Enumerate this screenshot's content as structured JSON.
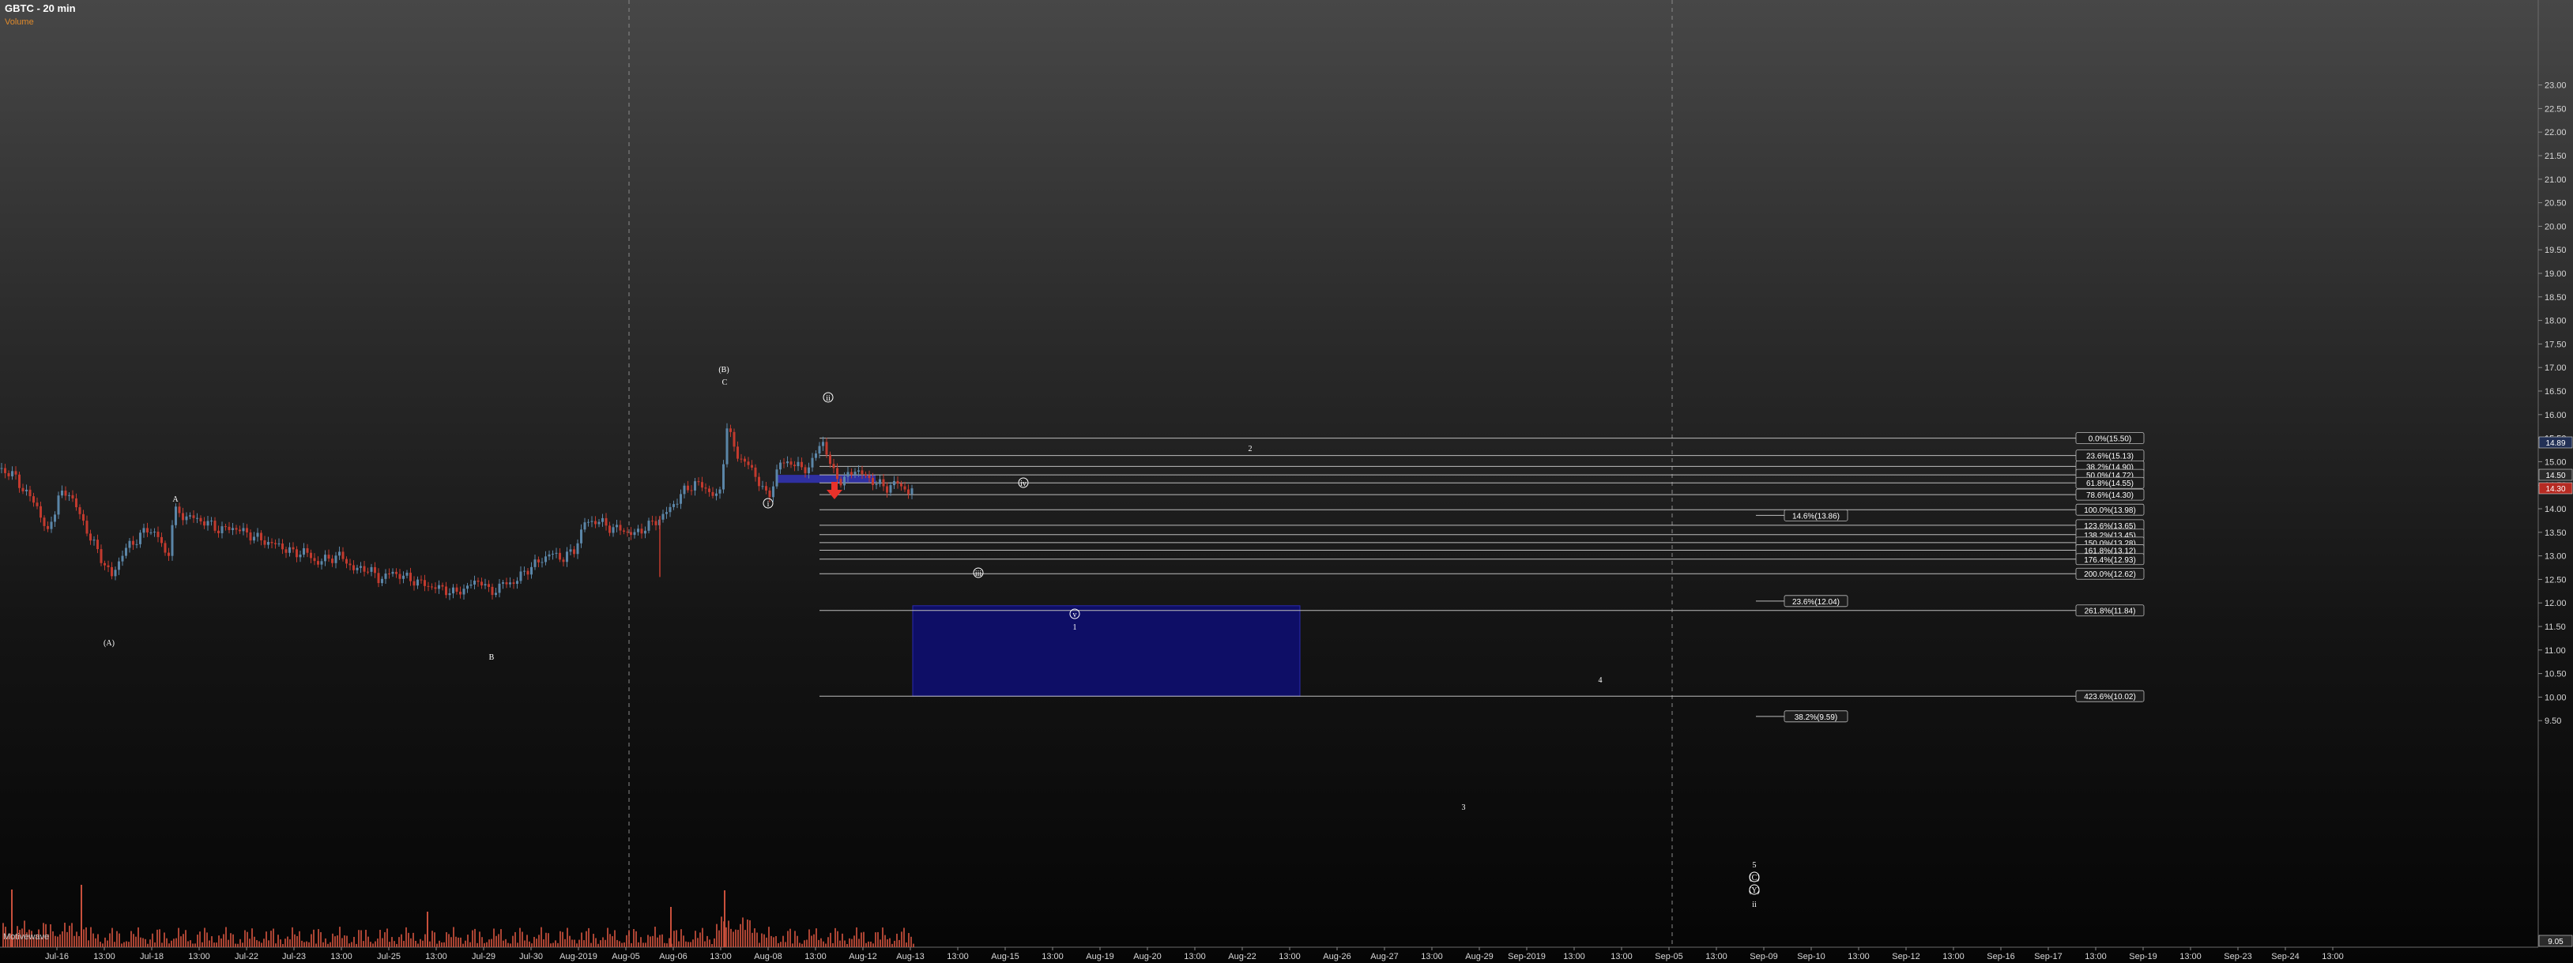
{
  "header": {
    "title": "GBTC - 20 min",
    "subtitle": "Volume"
  },
  "watermark": "Motivewave",
  "colors": {
    "grid": "#8a8a8a",
    "fib_line": "#bdbdbd",
    "candle_up": "#5b86a8",
    "candle_down": "#c23a2e",
    "volume": "#c9503c",
    "zone_fill": "#0e0e66",
    "zone_small": "#3234b8",
    "label_fill": "#1c1c1c",
    "arrow": "#e8322a"
  },
  "chart_data": {
    "type": "candlestick",
    "y_axis": {
      "range": [
        9.05,
        23.5
      ],
      "ticks": [
        "9.50",
        "10.00",
        "10.50",
        "11.00",
        "11.50",
        "12.00",
        "12.50",
        "13.00",
        "13.50",
        "14.00",
        "14.50",
        "15.00",
        "15.50",
        "16.00",
        "16.50",
        "17.00",
        "17.50",
        "18.00",
        "18.50",
        "19.00",
        "19.50",
        "20.00",
        "20.50",
        "21.00",
        "21.50",
        "22.00",
        "22.50",
        "23.00"
      ],
      "price_tags": [
        "14.89",
        "14.50",
        "14.30",
        "9.05"
      ]
    },
    "x_axis": {
      "labels": [
        "Jul-16",
        "13:00",
        "Jul-18",
        "13:00",
        "Jul-22",
        "Jul-23",
        "13:00",
        "Jul-25",
        "13:00",
        "Jul-29",
        "Jul-30",
        "Aug-2019",
        "Aug-05",
        "Aug-06",
        "13:00",
        "Aug-08",
        "13:00",
        "Aug-12",
        "Aug-13",
        "13:00",
        "Aug-15",
        "13:00",
        "Aug-19",
        "Aug-20",
        "13:00",
        "Aug-22",
        "13:00",
        "Aug-26",
        "Aug-27",
        "13:00",
        "Aug-29",
        "Sep-2019",
        "13:00",
        "13:00",
        "Sep-05",
        "13:00",
        "Sep-09",
        "Sep-10",
        "13:00",
        "Sep-12",
        "13:00",
        "Sep-16",
        "Sep-17",
        "13:00",
        "Sep-19",
        "13:00",
        "Sep-23",
        "Sep-24",
        "13:00"
      ]
    },
    "fib_levels": [
      {
        "label": "0.0%(15.50)",
        "value": 15.5
      },
      {
        "label": "23.6%(15.13)",
        "value": 15.13
      },
      {
        "label": "38.2%(14.90)",
        "value": 14.9
      },
      {
        "label": "50.0%(14.72)",
        "value": 14.72
      },
      {
        "label": "61.8%(14.55)",
        "value": 14.55
      },
      {
        "label": "78.6%(14.30)",
        "value": 14.3
      },
      {
        "label": "100.0%(13.98)",
        "value": 13.98
      },
      {
        "label": "123.6%(13.65)",
        "value": 13.65
      },
      {
        "label": "138.2%(13.45)",
        "value": 13.45
      },
      {
        "label": "150.0%(13.28)",
        "value": 13.28
      },
      {
        "label": "161.8%(13.12)",
        "value": 13.12
      },
      {
        "label": "176.4%(12.93)",
        "value": 12.93
      },
      {
        "label": "200.0%(12.62)",
        "value": 12.62
      },
      {
        "label": "261.8%(11.84)",
        "value": 11.84
      },
      {
        "label": "423.6%(10.02)",
        "value": 10.02
      }
    ],
    "side_fibs": [
      {
        "label": "14.6%(13.86)",
        "value": 13.86
      },
      {
        "label": "23.6%(12.04)",
        "value": 12.04
      },
      {
        "label": "38.2%(9.59)",
        "value": 9.59
      }
    ],
    "zones": [
      {
        "name": "target-zone",
        "top": 11.94,
        "bottom": 10.02
      },
      {
        "name": "resistance-zone",
        "top": 14.72,
        "bottom": 14.55
      }
    ],
    "wave_labels": [
      "(A)",
      "A",
      "B",
      "(B)",
      "C",
      "i",
      "ii",
      "iii",
      "iv",
      "v",
      "1",
      "2",
      "3",
      "4",
      "5",
      "(C)",
      "(Y)",
      "ii"
    ],
    "price_path": [
      [
        0,
        14.85
      ],
      [
        18,
        14.7
      ],
      [
        32,
        14.35
      ],
      [
        46,
        14.1
      ],
      [
        60,
        13.45
      ],
      [
        74,
        14.25
      ],
      [
        88,
        14.35
      ],
      [
        100,
        13.9
      ],
      [
        114,
        13.4
      ],
      [
        128,
        12.95
      ],
      [
        142,
        12.55
      ],
      [
        156,
        13.1
      ],
      [
        170,
        13.3
      ],
      [
        184,
        13.55
      ],
      [
        198,
        13.5
      ],
      [
        212,
        12.9
      ],
      [
        220,
        13.95
      ],
      [
        232,
        13.85
      ],
      [
        246,
        13.8
      ],
      [
        262,
        13.7
      ],
      [
        278,
        13.55
      ],
      [
        296,
        13.6
      ],
      [
        316,
        13.45
      ],
      [
        336,
        13.3
      ],
      [
        356,
        13.2
      ],
      [
        372,
        13.05
      ],
      [
        386,
        13.1
      ],
      [
        400,
        12.85
      ],
      [
        416,
        12.95
      ],
      [
        432,
        13.0
      ],
      [
        448,
        12.7
      ],
      [
        464,
        12.75
      ],
      [
        480,
        12.5
      ],
      [
        496,
        12.65
      ],
      [
        512,
        12.55
      ],
      [
        528,
        12.45
      ],
      [
        544,
        12.35
      ],
      [
        560,
        12.3
      ],
      [
        576,
        12.2
      ],
      [
        592,
        12.35
      ],
      [
        608,
        12.5
      ],
      [
        620,
        12.2
      ],
      [
        636,
        12.4
      ],
      [
        652,
        12.45
      ],
      [
        666,
        12.7
      ],
      [
        680,
        12.85
      ],
      [
        696,
        13.05
      ],
      [
        712,
        12.95
      ],
      [
        726,
        13.1
      ],
      [
        740,
        13.7
      ],
      [
        756,
        13.75
      ],
      [
        772,
        13.6
      ],
      [
        788,
        13.55
      ],
      [
        802,
        13.45
      ],
      [
        816,
        13.6
      ],
      [
        832,
        13.75
      ],
      [
        848,
        14.0
      ],
      [
        864,
        14.35
      ],
      [
        880,
        14.55
      ],
      [
        896,
        14.4
      ],
      [
        910,
        14.2
      ],
      [
        920,
        15.75
      ],
      [
        932,
        15.15
      ],
      [
        946,
        14.95
      ],
      [
        960,
        14.6
      ],
      [
        972,
        14.2
      ],
      [
        986,
        14.95
      ],
      [
        1000,
        15.0
      ],
      [
        1014,
        14.85
      ],
      [
        1026,
        14.9
      ],
      [
        1040,
        15.5
      ],
      [
        1052,
        14.85
      ],
      [
        1066,
        14.55
      ],
      [
        1080,
        14.85
      ],
      [
        1094,
        14.7
      ],
      [
        1108,
        14.55
      ],
      [
        1122,
        14.45
      ],
      [
        1136,
        14.55
      ],
      [
        1150,
        14.35
      ],
      [
        1156,
        14.4
      ]
    ]
  }
}
